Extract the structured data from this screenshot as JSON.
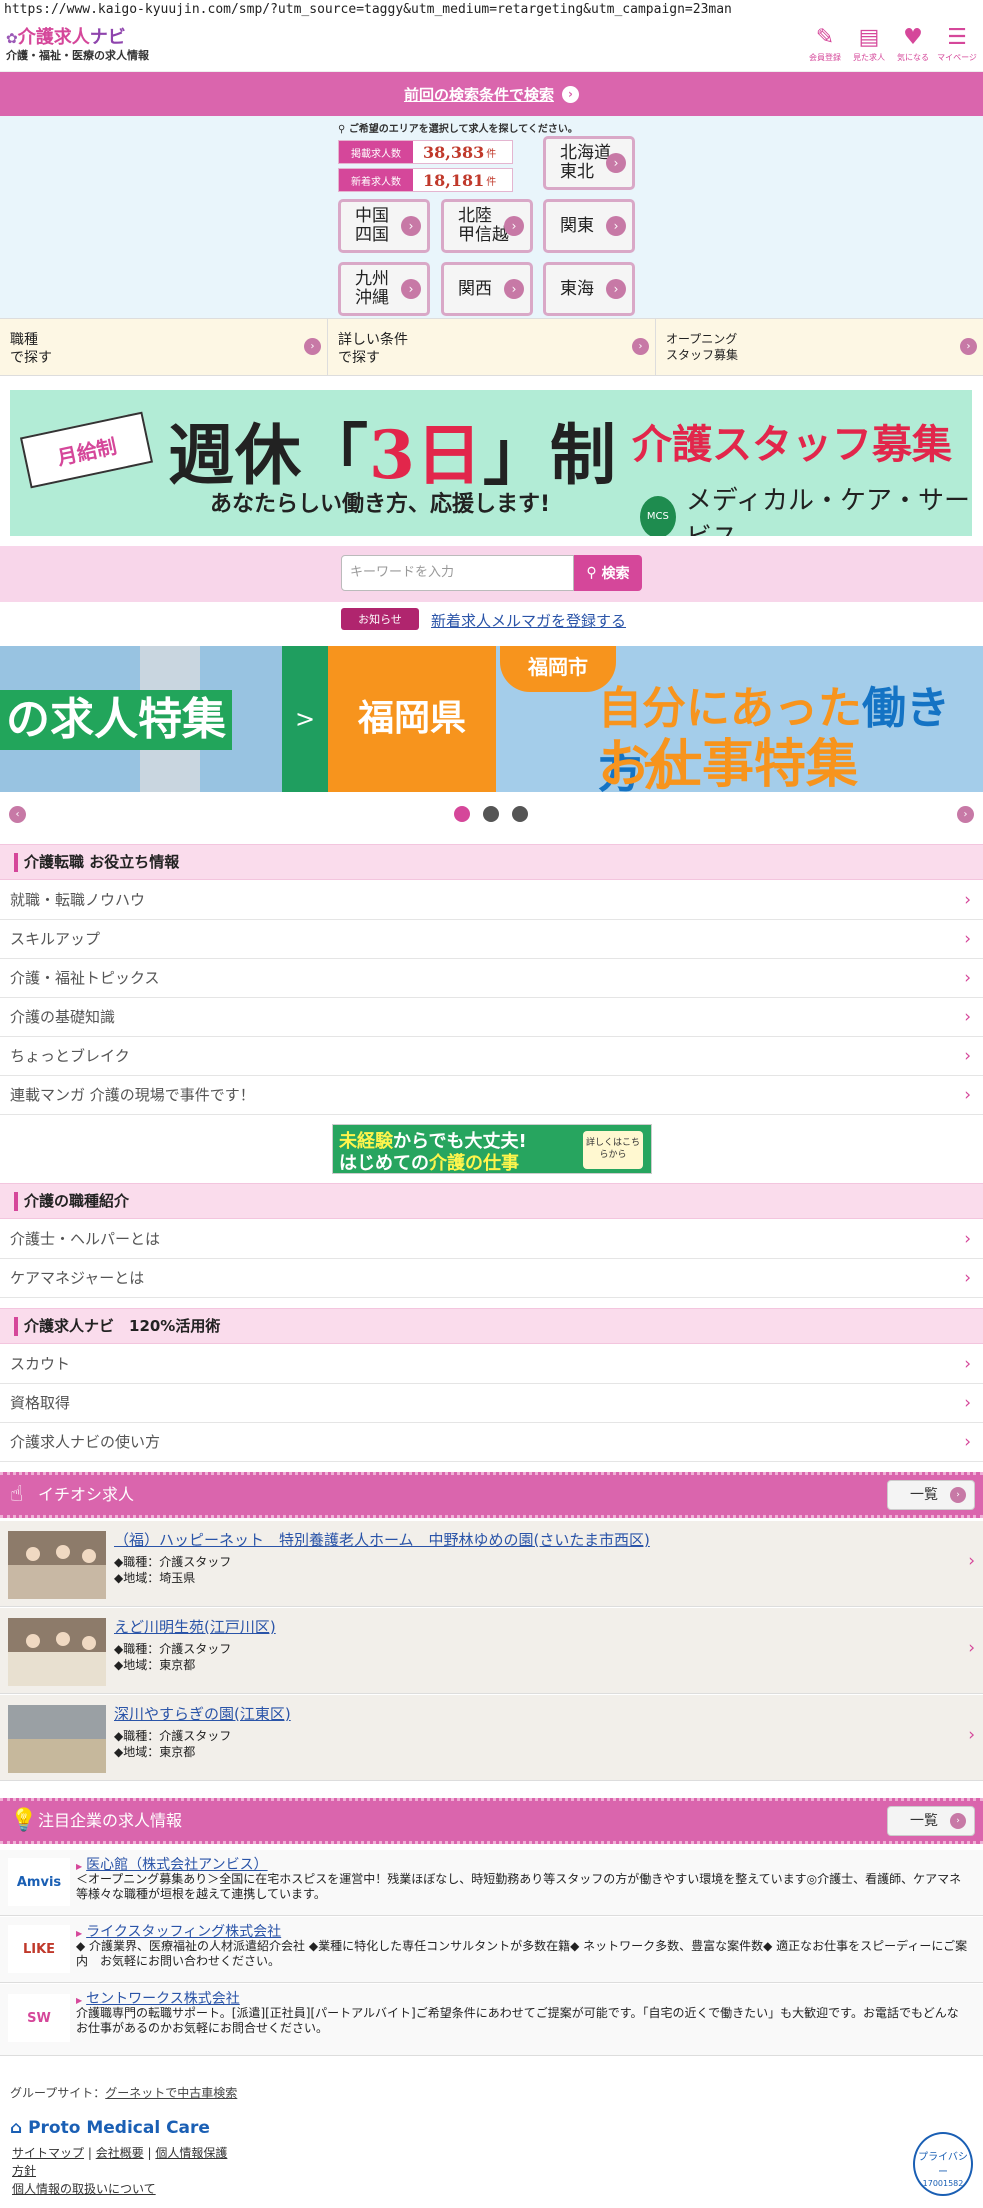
{
  "url": "https://www.kaigo-kyuujin.com/smp/?utm_source=taggy&utm_medium=retargeting&utm_campaign=23man",
  "header": {
    "logo_text": "介護求人",
    "logo_navi": "ナビ",
    "tagline": "介護・福祉・医療の求人情報",
    "icons": [
      {
        "name": "pen-icon",
        "label": "会員登録"
      },
      {
        "name": "clipboard-icon",
        "label": "見た求人"
      },
      {
        "name": "heart-icon",
        "label": "気になる"
      },
      {
        "name": "mypage-icon",
        "label": "マイページ"
      }
    ]
  },
  "prev_search": {
    "label": "前回の検索条件で検索"
  },
  "map": {
    "hint": "ご希望のエリアを選択して求人を探してください。",
    "stats": [
      {
        "label": "掲載求人数",
        "value": "38,383",
        "unit": "件"
      },
      {
        "label": "新着求人数",
        "value": "18,181",
        "unit": "件"
      }
    ],
    "regions": [
      "北海道\n東北",
      "中国\n四国",
      "北陸\n甲信越",
      "関東",
      "九州\n沖縄",
      "関西",
      "東海"
    ]
  },
  "search_options": [
    {
      "label": "職種\nで探す"
    },
    {
      "label": "詳しい条件\nで探す"
    },
    {
      "label": "オープニング\nスタッフ募集"
    }
  ],
  "banner": {
    "ribbon": "月給制",
    "main_pre": "週休「",
    "main_red": "3日",
    "main_post": "」制",
    "sub": "あなたらしい働き方、応援します!",
    "right_title": "介護スタッフ募集",
    "logo_mark": "MCS",
    "company": "メディカル・ケア・サービス"
  },
  "keyword": {
    "placeholder": "キーワードを入力",
    "button": "検索"
  },
  "notice": {
    "tag": "お知らせ",
    "link": "新着求人メルマガを登録する"
  },
  "slider": {
    "slide1": "の求人特集",
    "arrow": ">",
    "slide2": "福岡県",
    "city": "福岡市",
    "line1_a": "自分にあった",
    "line1_b": "働き方",
    "line1_c": "か",
    "line2": "お仕事特集",
    "active_index": 0,
    "dot_count": 3
  },
  "sections": {
    "tips": {
      "title": "介護転職 お役立ち情報",
      "items": [
        "就職・転職ノウハウ",
        "スキルアップ",
        "介護・福祉トピックス",
        "介護の基礎知識",
        "ちょっとブレイク",
        "連載マンガ 介護の現場で事件です！"
      ]
    },
    "mid_banner": {
      "line1_a": "未経験",
      "line1_b": "からでも大丈夫!",
      "line2_a": "はじめての",
      "line2_b": "介護の仕事",
      "badge": "詳しくはこちらから"
    },
    "jobtypes": {
      "title": "介護の職種紹介",
      "items": [
        "介護士・ヘルパーとは",
        "ケアマネジャーとは"
      ]
    },
    "usage": {
      "title": "介護求人ナビ　120%活用術",
      "items": [
        "スカウト",
        "資格取得",
        "介護求人ナビの使い方"
      ]
    }
  },
  "featured": {
    "title": "イチオシ求人",
    "more": "一覧",
    "jobs": [
      {
        "title": "（福）ハッピーネット　特別養護老人ホーム　中野林ゆめの園(さいたま市西区)",
        "job": "◆職種：介護スタッフ",
        "area": "◆地域：埼玉県"
      },
      {
        "title": "えど川明生苑(江戸川区)",
        "job": "◆職種：介護スタッフ",
        "area": "◆地域：東京都"
      },
      {
        "title": "深川やすらぎの園(江東区)",
        "job": "◆職種：介護スタッフ",
        "area": "◆地域：東京都"
      }
    ]
  },
  "companies": {
    "title": "注目企業の求人情報",
    "more": "一覧",
    "items": [
      {
        "logo": "Amvis",
        "name": "医心館（株式会社アンビス）",
        "desc": "＜オープニング募集あり＞全国に在宅ホスピスを運営中！残業ほぼなし、時短勤務あり等スタッフの方が働きやすい環境を整えています◎介護士、看護師、ケアマネ等様々な職種が垣根を越えて連携しています。"
      },
      {
        "logo": "LIKE",
        "name": "ライクスタッフィング株式会社",
        "desc": "◆ 介護業界、医療福祉の人材派遣紹介会社 ◆業種に特化した専任コンサルタントが多数在籍◆ ネットワーク多数、豊富な案件数◆ 適正なお仕事をスピーディーにご案内　お気軽にお問い合わせください。"
      },
      {
        "logo": "SW",
        "name": "セントワークス株式会社",
        "desc": "介護職専門の転職サポート。[派遣][正社員][パートアルバイト]ご希望条件にあわせてご提案が可能です。「自宅の近くで働きたい」も大歓迎です。お電話でもどんなお仕事があるのかお気軽にお問合せください。"
      }
    ]
  },
  "footer": {
    "group_label": "グループサイト：",
    "group_link": "グーネットで中古車検索",
    "brand": "Proto Medical Care",
    "links": [
      "サイトマップ",
      "会社概要",
      "個人情報保護",
      "方針",
      "個人情報の取扱いについて"
    ],
    "pmark_text": "プライバシー",
    "pmark_number": "17001582"
  },
  "colors": {
    "brand_pink": "#da65ad",
    "accent_pink": "#d5479a",
    "link_blue": "#2a54a8"
  }
}
